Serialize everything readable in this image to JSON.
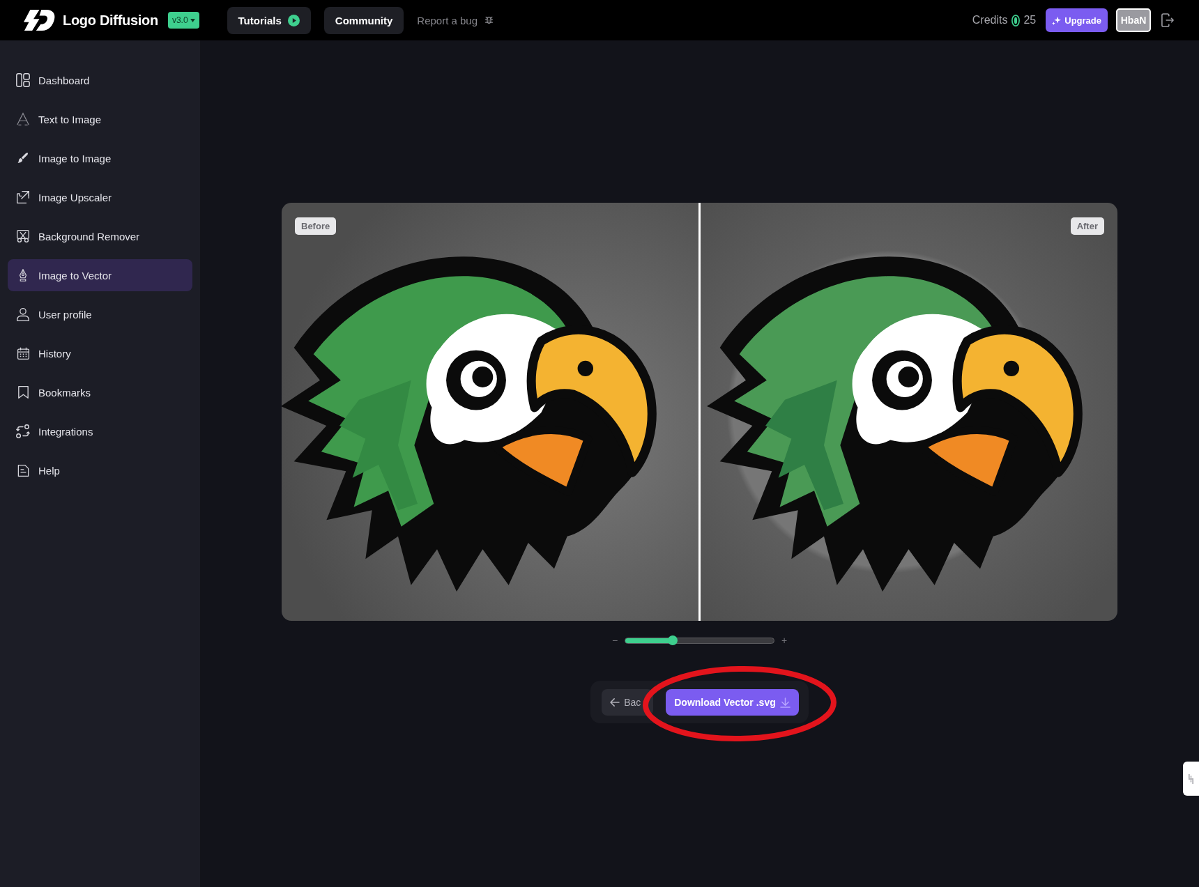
{
  "header": {
    "logo": "Logo Diffusion",
    "version": "v3.0",
    "nav": [
      {
        "label": "Tutorials",
        "kind": "button"
      },
      {
        "label": "Community",
        "kind": "button"
      },
      {
        "label": "Report a bug",
        "kind": "link"
      }
    ],
    "credits": {
      "label": "Credits",
      "amount": "25"
    },
    "upgrade": "Upgrade",
    "user": "HbaN"
  },
  "sidebar": {
    "items": [
      {
        "label": "Dashboard",
        "selected": false
      },
      {
        "label": "Text to Image",
        "selected": false
      },
      {
        "label": "Image to Image",
        "selected": false
      },
      {
        "label": "Image Upscaler",
        "selected": false
      },
      {
        "label": "Background Remover",
        "selected": false
      },
      {
        "label": "Image to Vector",
        "selected": true
      },
      {
        "label": "User profile",
        "selected": false
      },
      {
        "label": "History",
        "selected": false
      },
      {
        "label": "Bookmarks",
        "selected": false
      },
      {
        "label": "Integrations",
        "selected": false
      },
      {
        "label": "Help",
        "selected": false
      }
    ]
  },
  "comparison": {
    "before_label": "Before",
    "after_label": "After"
  },
  "zoom": {
    "minus": "−",
    "plus": "+",
    "level": 0.32
  },
  "actions": {
    "back": "Bac",
    "download": "Download Vector .svg"
  },
  "highlight": {
    "kind": "ellipse"
  }
}
